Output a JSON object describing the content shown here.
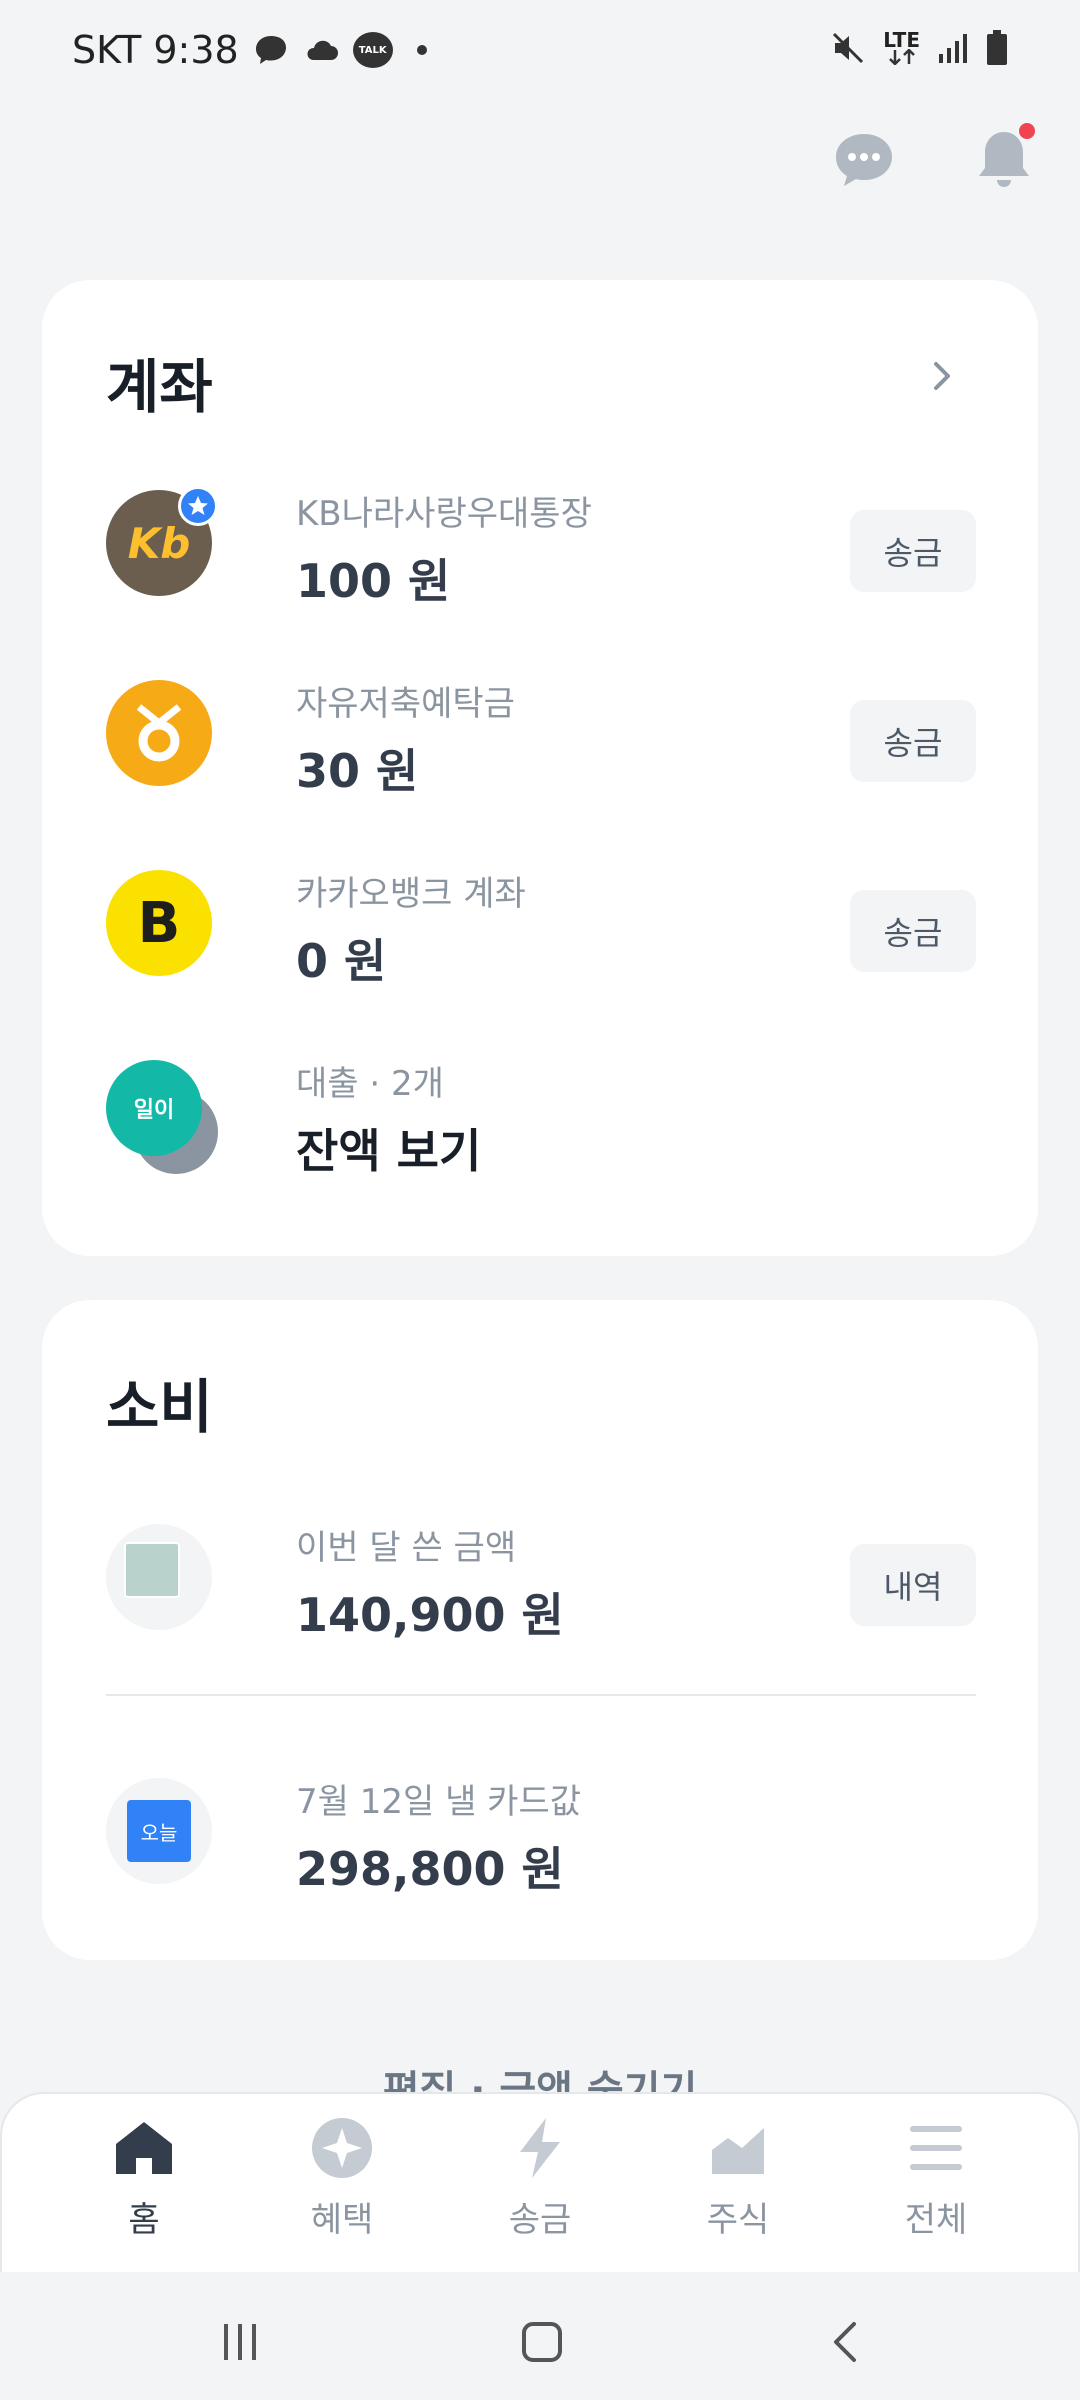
{
  "status_bar": {
    "carrier_time": "SKT 9:38",
    "talk_badge": "TALK",
    "network": "LTE"
  },
  "accounts": {
    "title": "계좌",
    "items": [
      {
        "name": "KB나라사랑우대통장",
        "amount": "100 원",
        "action": "송금",
        "logo_text": "Kb"
      },
      {
        "name": "자유저축예탁금",
        "amount": "30 원",
        "action": "송금"
      },
      {
        "name": "카카오뱅크 계좌",
        "amount": "0 원",
        "action": "송금",
        "logo_text": "B"
      },
      {
        "name": "대출 · 2개",
        "amount": "잔액 보기",
        "logo_text": "일이"
      }
    ]
  },
  "spending": {
    "title": "소비",
    "month": {
      "label": "이번 달 쓴 금액",
      "amount": "140,900 원",
      "action": "내역"
    },
    "card_bill": {
      "label": "7월 12일 낼 카드값",
      "amount": "298,800 원",
      "badge": "오늘"
    }
  },
  "footer_peek": "편집 · 금액 숨기기",
  "bottom_nav": [
    {
      "label": "홈",
      "icon": "home-icon",
      "active": true
    },
    {
      "label": "혜택",
      "icon": "benefit-icon",
      "active": false
    },
    {
      "label": "송금",
      "icon": "lightning-icon",
      "active": false
    },
    {
      "label": "주식",
      "icon": "stock-chart-icon",
      "active": false
    },
    {
      "label": "전체",
      "icon": "menu-icon",
      "active": false
    }
  ],
  "colors": {
    "background": "#f2f4f6",
    "kb_logo": "#6b5e4f",
    "savings_logo": "#f6ab16",
    "kakao_logo": "#fae100",
    "loan_logo": "#14b8a6",
    "card_badge": "#3182f6",
    "notification_dot": "#f04452"
  }
}
